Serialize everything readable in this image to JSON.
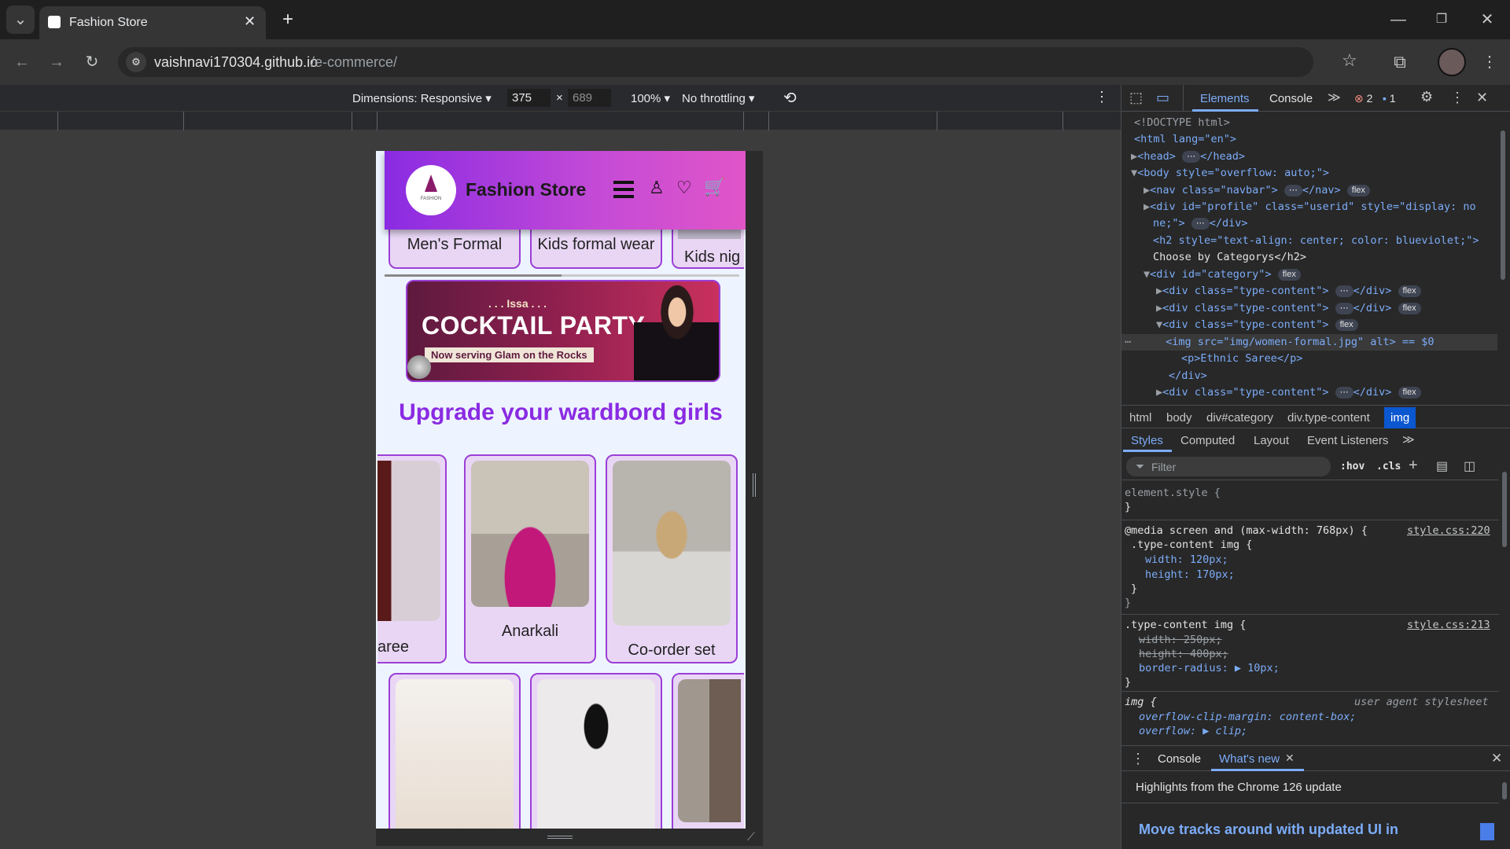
{
  "browser": {
    "tab_title": "Fashion Store",
    "url_domain": "vaishnavi170304.github.io",
    "url_path": "/e-commerce/"
  },
  "device_toolbar": {
    "dimensions_label": "Dimensions: Responsive",
    "width": "375",
    "height": "689",
    "zoom": "100%",
    "throttling": "No throttling"
  },
  "page": {
    "logo_text": "FASHION",
    "brand": "Fashion Store",
    "categories": [
      "Men's Formal",
      "Kids formal wear",
      "Kids nig"
    ],
    "banner": {
      "pre": ". . . Issa . . .",
      "headline": "COCKTAIL PARTY",
      "sub": "Now serving Glam on the Rocks"
    },
    "section_title": "Upgrade your wardbord girls",
    "products_row1": [
      "aree",
      "Anarkali",
      "Co-order set"
    ]
  },
  "devtools": {
    "tabs": [
      "Elements",
      "Console"
    ],
    "error_count": "2",
    "message_count": "1",
    "dom": [
      "<!DOCTYPE html>",
      "<html lang=\"en\">",
      "<head>",
      "<body style=\"overflow: auto;\">",
      "<nav class=\"navbar\">",
      "<div id=\"profile\" class=\"userid\" style=\"display: no",
      "ne;\">",
      "<h2 style=\"text-align: center; color: blueviolet;\">",
      "Choose by Categorys</h2>",
      "<div id=\"category\">",
      "<div class=\"type-content\">",
      "<div class=\"type-content\">",
      "<div class=\"type-content\">",
      "<img src=\"img/women-formal.jpg\" alt> == $0",
      "<p>Ethnic Saree</p>",
      "</div>",
      "<div class=\"type-content\">"
    ],
    "breadcrumbs": [
      "html",
      "body",
      "div#category",
      "div.type-content",
      "img"
    ],
    "style_tabs": [
      "Styles",
      "Computed",
      "Layout",
      "Event Listeners"
    ],
    "filter_placeholder": "Filter",
    "hov": ":hov",
    "cls": ".cls",
    "styles": {
      "element_style": "element.style {",
      "media": "@media screen and (max-width: 768px) {",
      "media_source": "style.css:220",
      "sel1": ".type-content img {",
      "w1": "width: 120px;",
      "h1": "height: 170px;",
      "sel2": ".type-content img {",
      "src2": "style.css:213",
      "w2": "width: 250px;",
      "h2": "height: 400px;",
      "radius": "border-radius: ▶ 10px;",
      "sel3": "img {",
      "ua": "user agent stylesheet",
      "ocm": "overflow-clip-margin: content-box;",
      "ovf": "overflow: ▶ clip;"
    },
    "drawer": {
      "tabs": [
        "Console",
        "What's new"
      ],
      "highlight": "Highlights from the Chrome 126 update",
      "headline": "Move tracks around with updated UI in"
    }
  },
  "colors": {
    "accent": "#8a2be2",
    "devtools_bg": "#282828",
    "tab_active": "#7cacf8"
  }
}
